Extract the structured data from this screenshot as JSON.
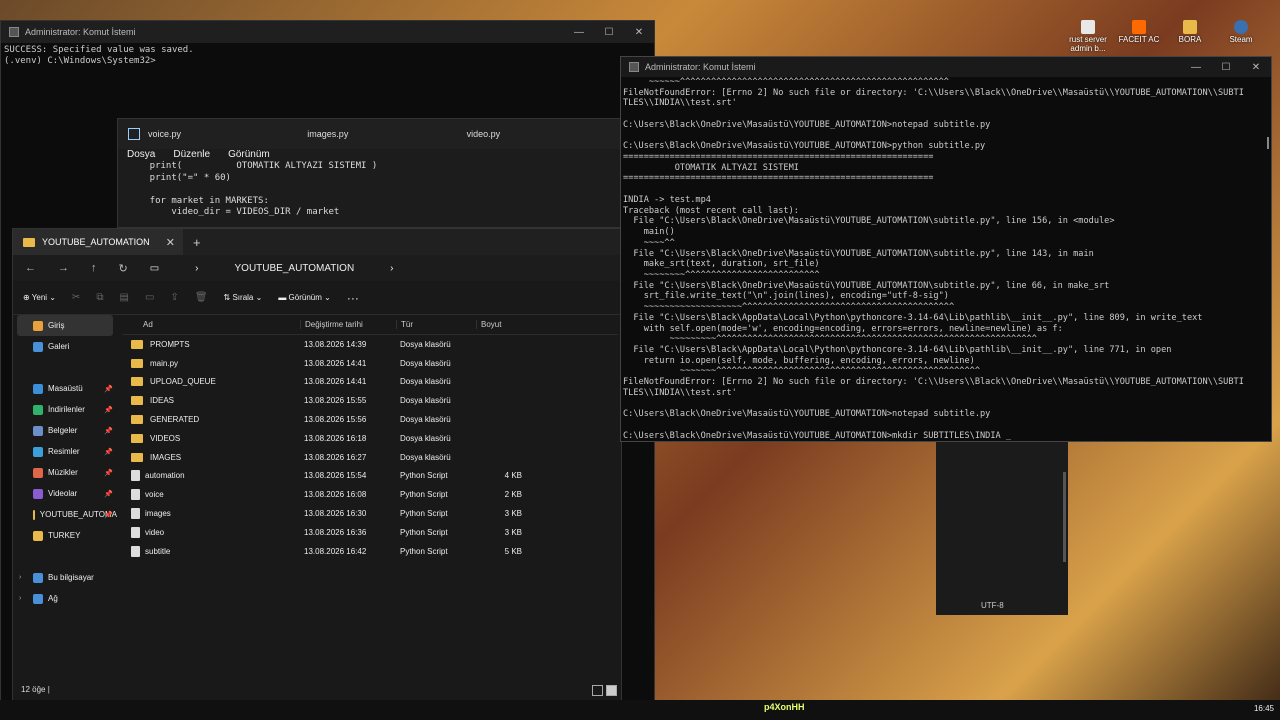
{
  "desktop_icons": [
    {
      "label": "rust server admin b...",
      "color": "#e8e8e8"
    },
    {
      "label": "FACEIT AC",
      "color": "#ff6a00"
    },
    {
      "label": "BORA",
      "color": "#e9b949"
    },
    {
      "label": "Steam",
      "color": "#3a6fb0"
    }
  ],
  "cmd_back": {
    "title": "Administrator: Komut İstemi",
    "lines": [
      "SUCCESS: Specified value was saved.",
      "",
      "(.venv) C:\\Windows\\System32>"
    ]
  },
  "notepad": {
    "tabs": [
      "voice.py",
      "images.py",
      "video.py"
    ],
    "menu": [
      "Dosya",
      "Düzenle",
      "Görünüm"
    ],
    "code": "    print(          OTOMATIK ALTYAZI SISTEMI )\n    print(\"=\" * 60)\n\n    for market in MARKETS:\n        video_dir = VIDEOS_DIR / market",
    "encoding": "UTF-8"
  },
  "explorer": {
    "tab_title": "YOUTUBE_AUTOMATION",
    "breadcrumb": "YOUTUBE_AUTOMATION",
    "toolbar": {
      "new": "Yeni",
      "sort": "Sırala",
      "view": "Görünüm",
      "more": "···"
    },
    "nav": [
      {
        "label": "Giriş",
        "color": "#e9a13b",
        "selected": true
      },
      {
        "label": "Galeri",
        "color": "#4a90d9"
      },
      {
        "label": "",
        "color": ""
      },
      {
        "label": "Masaüstü",
        "color": "#3b8fd9",
        "pin": true
      },
      {
        "label": "İndirilenler",
        "color": "#2fb36b",
        "pin": true
      },
      {
        "label": "Belgeler",
        "color": "#6c8fc7",
        "pin": true
      },
      {
        "label": "Resimler",
        "color": "#3ba0d9",
        "pin": true
      },
      {
        "label": "Müzikler",
        "color": "#e0664a",
        "pin": true
      },
      {
        "label": "Videolar",
        "color": "#8a5cd1",
        "pin": true
      },
      {
        "label": "YOUTUBE_AUTOMA",
        "color": "#e9b949",
        "pin": true
      },
      {
        "label": "TURKEY",
        "color": "#e9b949"
      },
      {
        "label": "",
        "color": ""
      },
      {
        "label": "Bu bilgisayar",
        "color": "#4a90d9",
        "expand": true
      },
      {
        "label": "Ağ",
        "color": "#4a90d9",
        "expand": true
      }
    ],
    "columns": [
      "Ad",
      "Değiştirme tarihi",
      "Tür",
      "Boyut"
    ],
    "files": [
      {
        "name": "PROMPTS",
        "date": "13.08.2026 14:39",
        "type": "Dosya klasörü",
        "size": "",
        "kind": "folder"
      },
      {
        "name": "main.py",
        "date": "13.08.2026 14:41",
        "type": "Dosya klasörü",
        "size": "",
        "kind": "folder"
      },
      {
        "name": "UPLOAD_QUEUE",
        "date": "13.08.2026 14:41",
        "type": "Dosya klasörü",
        "size": "",
        "kind": "folder"
      },
      {
        "name": "IDEAS",
        "date": "13.08.2026 15:55",
        "type": "Dosya klasörü",
        "size": "",
        "kind": "folder"
      },
      {
        "name": "GENERATED",
        "date": "13.08.2026 15:56",
        "type": "Dosya klasörü",
        "size": "",
        "kind": "folder"
      },
      {
        "name": "VIDEOS",
        "date": "13.08.2026 16:18",
        "type": "Dosya klasörü",
        "size": "",
        "kind": "folder"
      },
      {
        "name": "IMAGES",
        "date": "13.08.2026 16:27",
        "type": "Dosya klasörü",
        "size": "",
        "kind": "folder"
      },
      {
        "name": "automation",
        "date": "13.08.2026 15:54",
        "type": "Python Script",
        "size": "4 KB",
        "kind": "py"
      },
      {
        "name": "voice",
        "date": "13.08.2026 16:08",
        "type": "Python Script",
        "size": "2 KB",
        "kind": "py"
      },
      {
        "name": "images",
        "date": "13.08.2026 16:30",
        "type": "Python Script",
        "size": "3 KB",
        "kind": "py"
      },
      {
        "name": "video",
        "date": "13.08.2026 16:36",
        "type": "Python Script",
        "size": "3 KB",
        "kind": "py"
      },
      {
        "name": "subtitle",
        "date": "13.08.2026 16:42",
        "type": "Python Script",
        "size": "5 KB",
        "kind": "py"
      }
    ],
    "status": "12 öğe  |"
  },
  "cmd_front": {
    "title": "Administrator: Komut İstemi",
    "text": "     ~~~~~~^^^^^^^^^^^^^^^^^^^^^^^^^^^^^^^^^^^^^^^^^^^^^^^^^^^^\nFileNotFoundError: [Errno 2] No such file or directory: 'C:\\\\Users\\\\Black\\\\OneDrive\\\\Masaüstü\\\\YOUTUBE_AUTOMATION\\\\SUBTI\nTLES\\\\INDIA\\\\test.srt'\n\nC:\\Users\\Black\\OneDrive\\Masaüstü\\YOUTUBE_AUTOMATION>notepad subtitle.py\n\nC:\\Users\\Black\\OneDrive\\Masaüstü\\YOUTUBE_AUTOMATION>python subtitle.py\n============================================================\n          OTOMATIK ALTYAZI SISTEMI\n============================================================\n\nINDIA -> test.mp4\nTraceback (most recent call last):\n  File \"C:\\Users\\Black\\OneDrive\\Masaüstü\\YOUTUBE_AUTOMATION\\subtitle.py\", line 156, in <module>\n    main()\n    ~~~~^^\n  File \"C:\\Users\\Black\\OneDrive\\Masaüstü\\YOUTUBE_AUTOMATION\\subtitle.py\", line 143, in main\n    make_srt(text, duration, srt_file)\n    ~~~~~~~~^^^^^^^^^^^^^^^^^^^^^^^^^^\n  File \"C:\\Users\\Black\\OneDrive\\Masaüstü\\YOUTUBE_AUTOMATION\\subtitle.py\", line 66, in make_srt\n    srt_file.write_text(\"\\n\".join(lines), encoding=\"utf-8-sig\")\n    ~~~~~~~~~~~~~~~~~~~^^^^^^^^^^^^^^^^^^^^^^^^^^^^^^^^^^^^^^^^^\n  File \"C:\\Users\\Black\\AppData\\Local\\Python\\pythoncore-3.14-64\\Lib\\pathlib\\__init__.py\", line 809, in write_text\n    with self.open(mode='w', encoding=encoding, errors=errors, newline=newline) as f:\n         ~~~~~~~~~^^^^^^^^^^^^^^^^^^^^^^^^^^^^^^^^^^^^^^^^^^^^^^^^^^^^^^^^^^^^^^\n  File \"C:\\Users\\Black\\AppData\\Local\\Python\\pythoncore-3.14-64\\Lib\\pathlib\\__init__.py\", line 771, in open\n    return io.open(self, mode, buffering, encoding, errors, newline)\n           ~~~~~~~^^^^^^^^^^^^^^^^^^^^^^^^^^^^^^^^^^^^^^^^^^^^^^^^^^^\nFileNotFoundError: [Errno 2] No such file or directory: 'C:\\\\Users\\\\Black\\\\OneDrive\\\\Masaüstü\\\\YOUTUBE_AUTOMATION\\\\SUBTI\nTLES\\\\INDIA\\\\test.srt'\n\nC:\\Users\\Black\\OneDrive\\Masaüstü\\YOUTUBE_AUTOMATION>notepad subtitle.py\n\nC:\\Users\\Black\\OneDrive\\Masaüstü\\YOUTUBE_AUTOMATION>mkdir SUBTITLES\\INDIA _"
  },
  "taskbar": {
    "brand": "p4XonHH",
    "clock": "16:45"
  }
}
